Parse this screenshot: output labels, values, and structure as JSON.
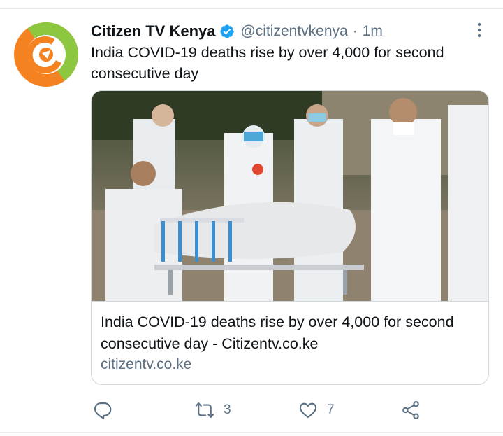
{
  "tweet": {
    "display_name": "Citizen TV Kenya",
    "handle": "@citizentvkenya",
    "separator": "·",
    "time": "1m",
    "text": "India COVID-19 deaths rise by over 4,000 for second consecutive day",
    "verified": true
  },
  "card": {
    "title": "India COVID-19 deaths rise by over 4,000 for second consecutive day - Citizentv.co.ke",
    "domain": "citizentv.co.ke"
  },
  "actions": {
    "reply_count": "",
    "retweet_count": "3",
    "like_count": "7"
  },
  "icons": {
    "more": "more-vertical-icon",
    "verified": "verified-badge-icon",
    "reply": "reply-icon",
    "retweet": "retweet-icon",
    "like": "heart-icon",
    "share": "share-icon"
  },
  "colors": {
    "verified_blue": "#1da1f2",
    "secondary_text": "#5b7083",
    "brand_orange": "#f58220",
    "brand_green": "#8dc63f"
  }
}
